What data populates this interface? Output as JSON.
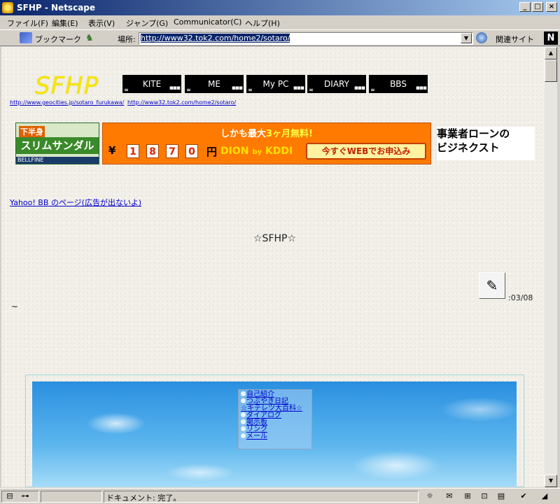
{
  "window": {
    "title": "SFHP - Netscape",
    "buttons": [
      "_",
      "□",
      "×"
    ]
  },
  "menu": {
    "items": [
      "ファイル(F)",
      "編集(E)",
      "表示(V)",
      "ジャンプ(G)",
      "Communicator(C)",
      "ヘルプ(H)"
    ]
  },
  "toolbar": {
    "bookmarks_label": "ブックマーク",
    "location_label": "場所:",
    "url": "http://www32.tok2.com/home2/sotaro/",
    "related_label": "関連サイト",
    "brand_letter": "N"
  },
  "page": {
    "logo": "SFHP",
    "nav_buttons": [
      "KITE",
      "ME",
      "My PC",
      "DIARY",
      "BBS"
    ],
    "top_links": [
      "http://www.geocities.jp/sotaro_furukawa/",
      "http://www32.tok2.com/home2/sotaro/"
    ],
    "ad_left": {
      "line1": "下半身",
      "line2": "スリムサンダル",
      "line3": "BELLFINE"
    },
    "ad_main": {
      "headline_prefix": "しかも最大",
      "headline_highlight": "3ヶ月無料!",
      "yen": "¥",
      "digits": [
        "1",
        "8",
        "7",
        "0"
      ],
      "en": "円",
      "brand": "DION",
      "brand_by": "by",
      "brand_co": "KDDI",
      "cta": "今すぐWEBでお申込み"
    },
    "ad_right": {
      "line1": "事業者ローンの",
      "line2": "ビジネクスト"
    },
    "yahoo_link": "Yahoo! BB のページ(広告が出ないよ)",
    "center_title": "☆SFHP☆",
    "date": ":03/08",
    "tilde": "~",
    "side_menu": [
      "自己紹介",
      "つぶやき日記",
      "☆キテレツ大百科☆",
      "ダイアログ",
      "掲示板",
      "リンク",
      "メール"
    ]
  },
  "status": {
    "text": "ドキュメント: 完了。"
  }
}
